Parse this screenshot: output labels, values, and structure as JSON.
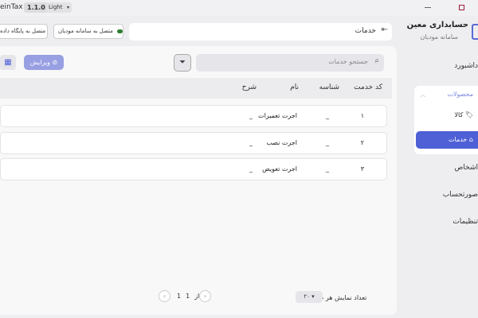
{
  "titlebar": {
    "app_name": "einTax",
    "version": "1.1.0",
    "theme": "Light"
  },
  "sidebar": {
    "brand_title": "حسابداری معین",
    "brand_subtitle": "سامانه مودیان",
    "items": {
      "dashboard": "داشبورد",
      "products": "محصولات",
      "goods": "کالا",
      "services": "خدمات",
      "persons": "اشخاص",
      "statements": "صورتحساب",
      "settings": "تنظیمات"
    }
  },
  "toolbar": {
    "connect_db": "متصل به پایگاه داده",
    "connect_portal": "متصل به سامانه مودیان",
    "breadcrumb": "خدمات"
  },
  "panel": {
    "search_placeholder": "جستجو خدمات",
    "edit_label": "ویرایش",
    "columns": {
      "code": "کد خدمت",
      "id": "شناسه",
      "name": "نام",
      "desc": "شرح"
    },
    "rows": [
      {
        "code": "۱",
        "id": "_",
        "name": "اجرت تعمیرات",
        "desc": "_"
      },
      {
        "code": "۲",
        "id": "_",
        "name": "اجرت نصب",
        "desc": "_"
      },
      {
        "code": "۳",
        "id": "_",
        "name": "اجرت تعویض",
        "desc": "_"
      }
    ],
    "pagination": {
      "page_size_label": "تعداد نمایش هر صفحه",
      "page_size": "۲۰",
      "current": "1",
      "of": "از",
      "total": "1"
    }
  },
  "colors": {
    "accent": "#4f5fd6",
    "accent_light": "#98a0e3",
    "cloud": "#2e7d32",
    "close": "#9b1b3a"
  }
}
